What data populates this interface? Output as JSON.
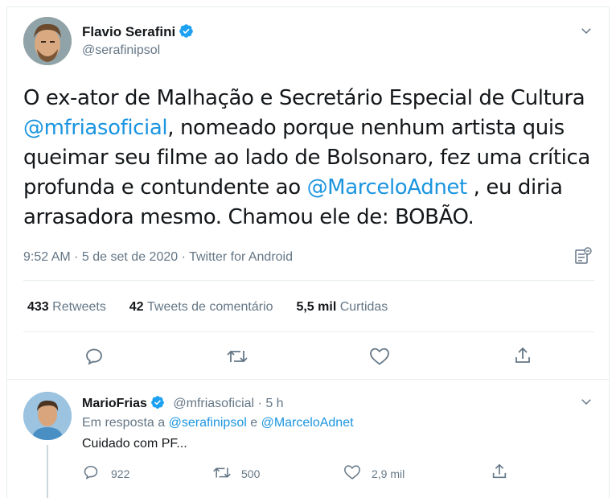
{
  "tweet": {
    "author_name": "Flavio Serafini",
    "author_handle": "@serafinipsol",
    "text_lines": [
      [
        "O ex-ator de Malhação e Secretário Especial de Cultura"
      ],
      [
        "@mfriasoficial",
        ", nomeado porque nenhum artista quis"
      ],
      [
        "queimar seu filme ao lado de Bolsonaro, fez uma crítica"
      ],
      [
        "profunda e contundente ao ",
        "@MarceloAdnet",
        " , eu diria"
      ],
      [
        "arrasadora mesmo. Chamou ele de: BOBÃO."
      ]
    ],
    "timestamp": "9:52 AM · 5 de set de 2020 · Twitter for Android",
    "stats": {
      "retweets_count": "433",
      "retweets_label": "Retweets",
      "comments_count": "42",
      "comments_label": "Tweets de comentário",
      "likes_count": "5,5 mil",
      "likes_label": "Curtidas"
    }
  },
  "reply": {
    "author_name": "MarioFrias",
    "author_handle": "@mfriasoficial",
    "separator": "·",
    "time_ago": "5 h",
    "in_reply_prefix": "Em resposta a ",
    "in_reply_user1": "@serafinipsol",
    "in_reply_and": " e ",
    "in_reply_user2": "@MarceloAdnet",
    "text": "Cuidado com PF...",
    "reply_count": "922",
    "retweet_count": "500",
    "like_count": "2,9 mil"
  },
  "colors": {
    "accent": "#1b95e0",
    "verified": "#1da1f2",
    "muted": "#657786",
    "divider": "#e6ecf0"
  },
  "icons": [
    "verified-badge-icon",
    "chevron-down-icon",
    "analytics-icon",
    "reply-icon",
    "retweet-icon",
    "like-icon",
    "share-icon"
  ]
}
